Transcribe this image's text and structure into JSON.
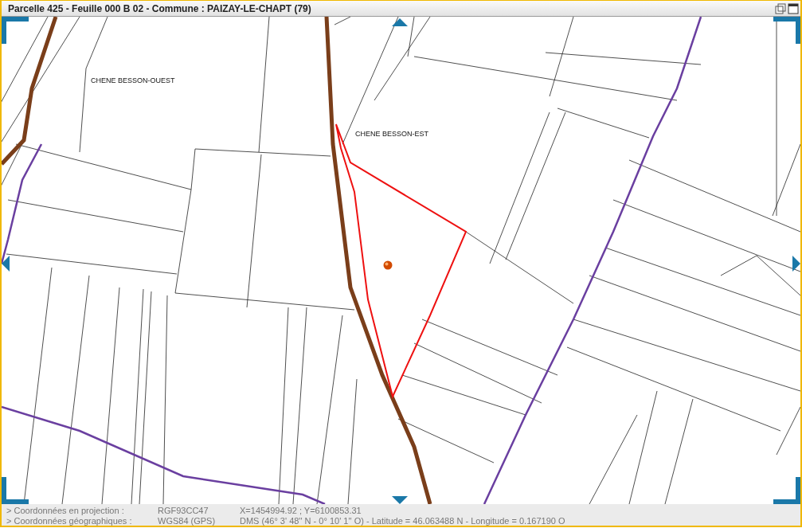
{
  "window": {
    "title": "Parcelle 425 - Feuille 000 B 02 - Commune : PAIZAY-LE-CHAPT (79)"
  },
  "map": {
    "labels": [
      "CHENE BESSON-OUEST",
      "CHENE BESSON-EST"
    ]
  },
  "status_bar": [
    {
      "label": "> Coordonnées en projection :",
      "system": "RGF93CC47",
      "value": "X=1454994.92 ; Y=6100853.31"
    },
    {
      "label": "> Coordonnées géographiques :",
      "system": "WGS84 (GPS)",
      "value": "DMS (46° 3' 48'' N - 0° 10' 1'' O) - Latitude = 46.063488 N - Longitude = 0.167190 O"
    }
  ]
}
